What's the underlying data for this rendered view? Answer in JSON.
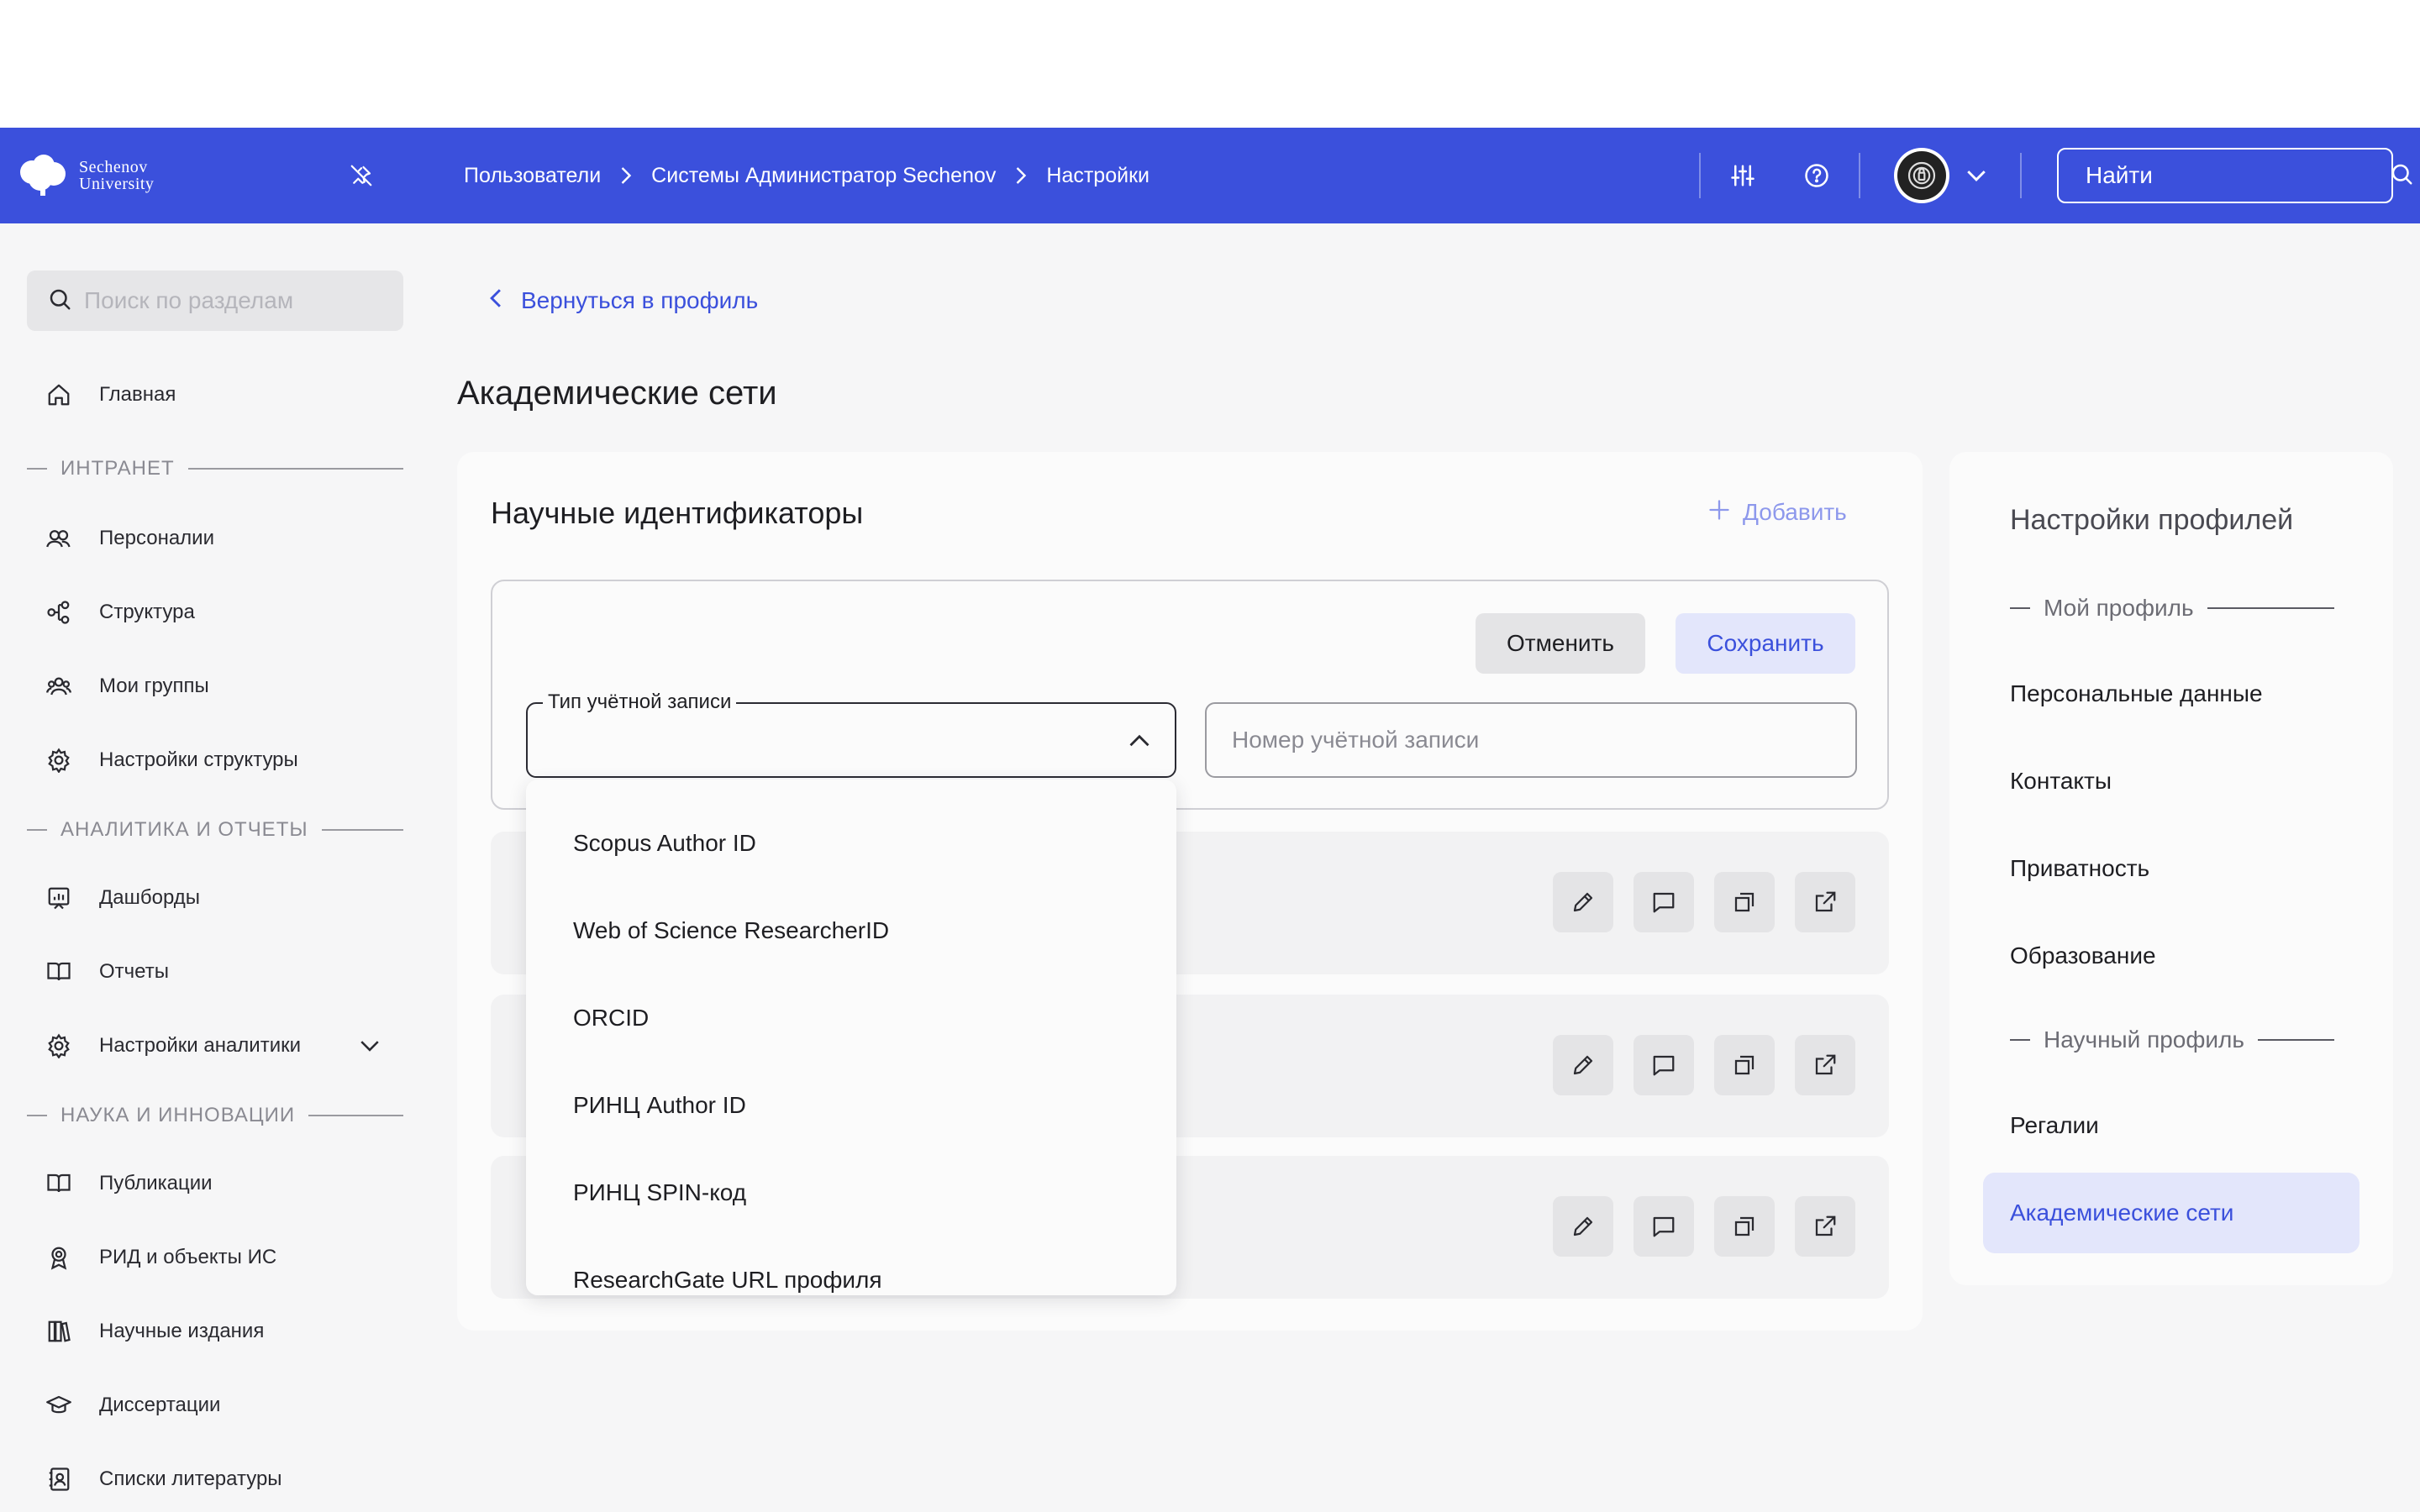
{
  "header": {
    "logo_line1": "Sechenov",
    "logo_line2": "University",
    "breadcrumbs": [
      "Пользователи",
      "Системы Администратор Sechenov",
      "Настройки"
    ],
    "search_placeholder": "Найти",
    "brand_color": "#3b50dc"
  },
  "sidebar": {
    "search_placeholder": "Поиск по разделам",
    "home": "Главная",
    "sections": {
      "intranet": "ИНТРАНЕТ",
      "analytics": "АНАЛИТИКА И ОТЧЕТЫ",
      "science": "НАУКА И ИННОВАЦИИ"
    },
    "intranet_items": [
      "Персоналии",
      "Структура",
      "Мои группы",
      "Настройки структуры"
    ],
    "analytics_items": [
      "Дашборды",
      "Отчеты",
      "Настройки аналитики"
    ],
    "science_items": [
      "Публикации",
      "РИД и объекты ИС",
      "Научные издания",
      "Диссертации",
      "Списки литературы"
    ]
  },
  "main": {
    "back_link": "Вернуться в профиль",
    "page_title": "Академические сети",
    "card_title": "Научные идентификаторы",
    "add_label": "Добавить",
    "cancel_label": "Отменить",
    "save_label": "Сохранить",
    "type_label": "Тип учётной записи",
    "number_placeholder": "Номер учётной записи",
    "dropdown_options": [
      "Scopus Author ID",
      "Web of Science ResearcherID",
      "ORCID",
      "РИНЦ Author ID",
      "РИНЦ SPIN-код",
      "ResearchGate URL профиля"
    ]
  },
  "right_panel": {
    "title": "Настройки профилей",
    "my_profile_section": "Мой профиль",
    "my_profile_items": [
      "Персональные данные",
      "Контакты",
      "Приватность",
      "Образование"
    ],
    "science_section": "Научный профиль",
    "science_items": [
      "Регалии"
    ],
    "active_item": "Академические сети"
  }
}
